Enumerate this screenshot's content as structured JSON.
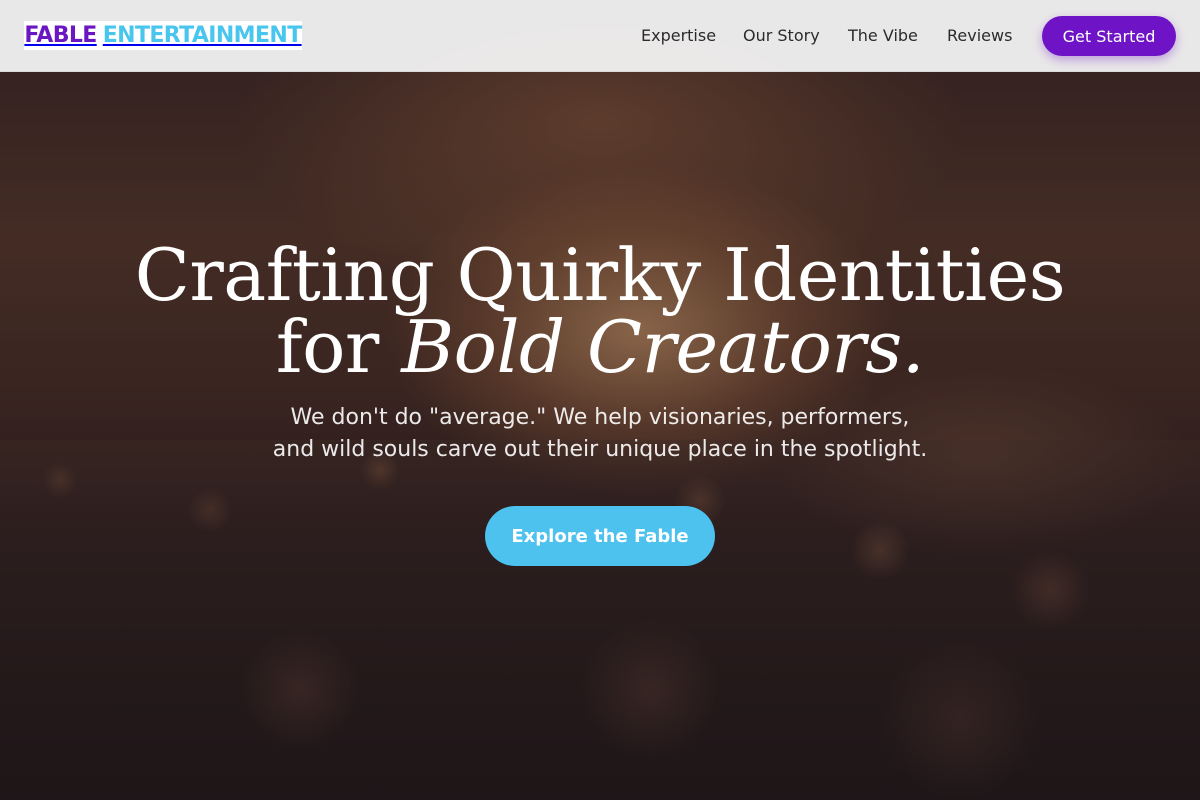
{
  "brand": {
    "part1": "FABLE",
    "part2": "ENTERTAINMENT",
    "color1": "#6a16c2",
    "color2": "#49c6ee"
  },
  "nav": {
    "links": [
      "Expertise",
      "Our Story",
      "The Vibe",
      "Reviews"
    ],
    "cta": "Get Started"
  },
  "hero": {
    "headline_line1": "Crafting Quirky Identities",
    "headline_line2_plain": "for",
    "headline_line2_italic": "Bold Creators.",
    "subtext_line1": "We don't do \"average.\" We help visionaries, performers,",
    "subtext_line2": "and wild souls carve out their unique place in the spotlight.",
    "cta": "Explore the Fable"
  },
  "colors": {
    "primary": "#6e14c6",
    "accent": "#4dc2ee"
  }
}
